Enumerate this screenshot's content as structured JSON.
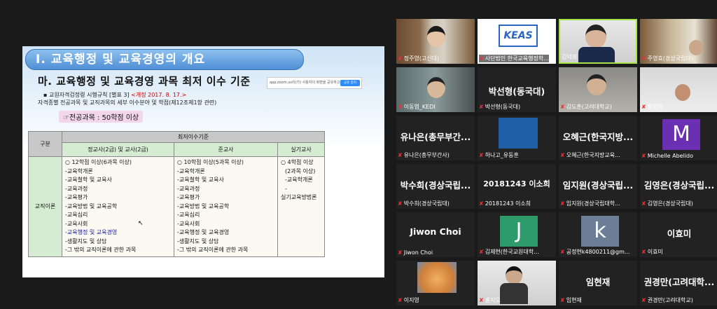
{
  "slide": {
    "title": "Ⅰ. 교육행정 및 교육경영의 개요",
    "subtitle": "마. 교육행정 및 교육경영 과목 최저 이수 기준",
    "note1_prefix": "▪ 교원자격검정령 시행규칙 [별표 3] ",
    "note1_revision": "<개정 2017. 8. 17.>",
    "note2": "자격종별 전공과목 및 교직과목의 세부 이수분야 및 학점(제12조제1항 관련)",
    "note3": "☞전공과목 : 50학점 이상",
    "table": {
      "col_category": "구분",
      "col_min": "최저이수기준",
      "col_regular": "정교사(2급) 및 교사(2급)",
      "col_quasi": "준교사",
      "col_practical": "실기교사",
      "row_label": "교직이론",
      "regular": [
        "○ 12학점 이상(6과목 이상)",
        "-교육학개론",
        "-교육철학 및 교육사",
        "-교육과정",
        "-교육평가",
        "-교육방법 및 교육공학",
        "-교육심리",
        "-교육사회",
        "-교육행정 및 교육경영",
        "-생활지도 및 상담",
        "-그 밖의 교직이론에 관한 과목"
      ],
      "quasi": [
        "○ 10학점 이상(5과목 이상)",
        "-교육학개론",
        "-교육철학 및 교육사",
        "-교육과정",
        "-교육평가",
        "-교육방법 및 교육공학",
        "-교육심리",
        "-교육사회",
        "-교육행정 및 교육경영",
        "-생활지도 및 상담",
        "-그 밖의 교직이론에 관한 과목"
      ],
      "practical": [
        "○ 4학점 이상",
        "(2과목 이상)",
        "-교육학개론",
        "-",
        "실기교육방법론"
      ]
    }
  },
  "share_popup": {
    "text": "app.zoom.us이(가) 사용자의 화면을 공유하고 있습니다.",
    "button": "공유 중지"
  },
  "colors": {
    "accent": "#2d8cff",
    "active_speaker": "#a6e34b",
    "muted": "#e0353b"
  },
  "participants": [
    {
      "name": "정주영(고신대)",
      "big": ""
    },
    {
      "name": "사단법인 한국교육행정학...",
      "big": ""
    },
    {
      "name": "김덕희",
      "big": ""
    },
    {
      "name": "주영효(경상국립대)",
      "big": ""
    },
    {
      "name": "이동엽_KEDI",
      "big": ""
    },
    {
      "name": "박선형(동국대)",
      "big": "박선형(동국대)"
    },
    {
      "name": "김도훈(고려대학교)",
      "big": ""
    },
    {
      "name": "황영자",
      "big": ""
    },
    {
      "name": "유나은(총무부간사)",
      "big": "유나은(총무부간..."
    },
    {
      "name": "하나고_유동훈",
      "big": ""
    },
    {
      "name": "오혜근(한국지방교육...",
      "big": "오혜근(한국지방..."
    },
    {
      "name": "Michelle Abelido",
      "big": "M"
    },
    {
      "name": "박수희(경상국립대)",
      "big": "박수희(경상국립..."
    },
    {
      "name": "20181243 이소희",
      "big": "20181243 이소희"
    },
    {
      "name": "임지원(경상국립대학...",
      "big": "임지원(경상국립..."
    },
    {
      "name": "김영은(경상국립대)",
      "big": "김영은(경상국립..."
    },
    {
      "name": "Jiwon Choi",
      "big": "Jiwon Choi"
    },
    {
      "name": "김제현(한국교원대학...",
      "big": "J"
    },
    {
      "name": "공정현k4800211@gm...",
      "big": "k"
    },
    {
      "name": "이효미",
      "big": "이효미"
    },
    {
      "name": "이지영",
      "big": ""
    },
    {
      "name": "홍지오",
      "big": ""
    },
    {
      "name": "임현재",
      "big": "임현재"
    },
    {
      "name": "권경만(고려대학교)",
      "big": "권경만(고려대학..."
    }
  ]
}
